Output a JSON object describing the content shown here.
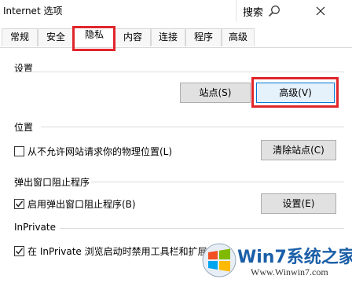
{
  "window": {
    "title": "Internet 选项",
    "search_label": "搜索"
  },
  "tabs": [
    {
      "label": "常规"
    },
    {
      "label": "安全"
    },
    {
      "label": "隐私"
    },
    {
      "label": "内容"
    },
    {
      "label": "连接"
    },
    {
      "label": "程序"
    },
    {
      "label": "高级"
    }
  ],
  "active_tab": "隐私",
  "settings": {
    "title": "设置",
    "sites_button": "站点(S)",
    "advanced_button": "高级(V)"
  },
  "location": {
    "title": "位置",
    "checkbox_label": "从不允许网站请求你的物理位置(L)",
    "checkbox_checked": false,
    "clear_button": "清除站点(C)"
  },
  "popup": {
    "title": "弹出窗口阻止程序",
    "checkbox_label": "启用弹出窗口阻止程序(B)",
    "checkbox_checked": true,
    "settings_button": "设置(E)"
  },
  "inprivate": {
    "title": "InPrivate",
    "checkbox_label": "在 InPrivate 浏览启动时禁用工具栏和扩展(T)",
    "checkbox_checked": true
  },
  "watermark": {
    "title": "Win7系统之家",
    "url": "Www.Winwin7.com"
  },
  "colors": {
    "highlight": "#e0252b",
    "focus": "#0078d7",
    "watermark": "#1a5ea8"
  }
}
